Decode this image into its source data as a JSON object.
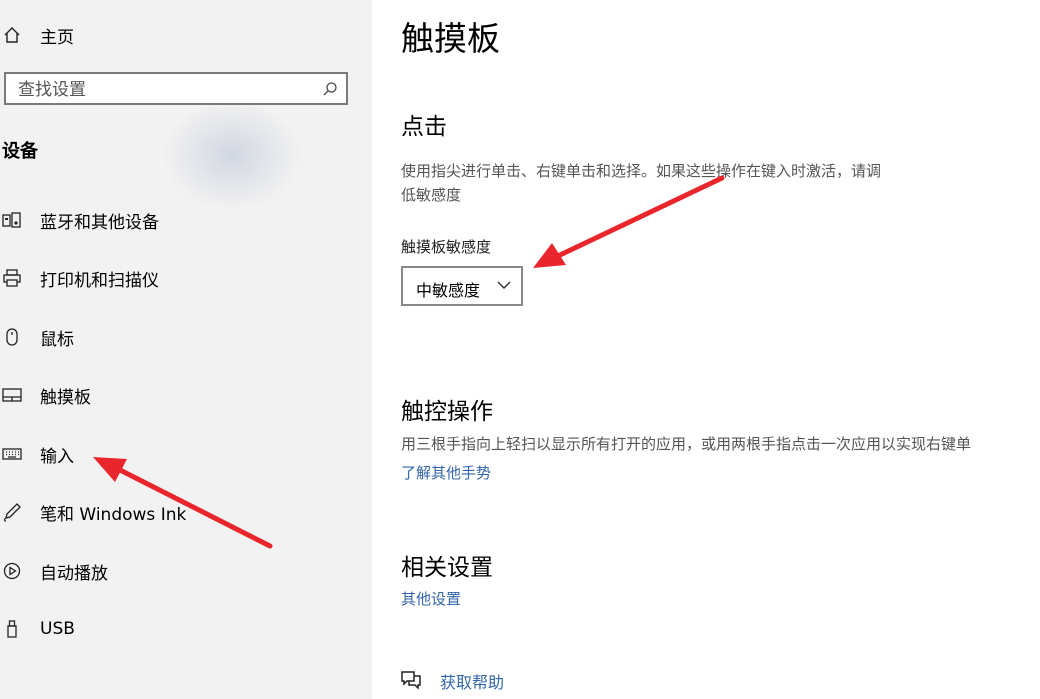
{
  "sidebar": {
    "home_label": "主页",
    "search": {
      "placeholder": "查找设置"
    },
    "section_title": "设备",
    "items": [
      {
        "label": "蓝牙和其他设备",
        "icon": "bluetooth-device-icon"
      },
      {
        "label": "打印机和扫描仪",
        "icon": "printer-icon"
      },
      {
        "label": "鼠标",
        "icon": "mouse-icon"
      },
      {
        "label": "触摸板",
        "icon": "touchpad-icon"
      },
      {
        "label": "输入",
        "icon": "keyboard-icon"
      },
      {
        "label": "笔和 Windows Ink",
        "icon": "pen-icon"
      },
      {
        "label": "自动播放",
        "icon": "autoplay-icon"
      },
      {
        "label": "USB",
        "icon": "usb-icon"
      }
    ]
  },
  "main": {
    "title": "触摸板",
    "tap": {
      "heading": "点击",
      "desc_line1": "使用指尖进行单击、右键单击和选择。如果这些操作在键入时激活，请调",
      "desc_line2": "低敏感度",
      "sensitivity_label": "触摸板敏感度",
      "sensitivity_value": "中敏感度"
    },
    "gestures": {
      "heading": "触控操作",
      "desc": "用三根手指向上轻扫以显示所有打开的应用，或用两根手指点击一次应用以实现右键单",
      "link": "了解其他手势"
    },
    "related": {
      "heading": "相关设置",
      "link": "其他设置"
    },
    "help_link": "获取帮助"
  },
  "colors": {
    "sidebar_bg": "#f2f2f2",
    "link": "#3366aa",
    "annotation_arrow": "#e8262b"
  }
}
